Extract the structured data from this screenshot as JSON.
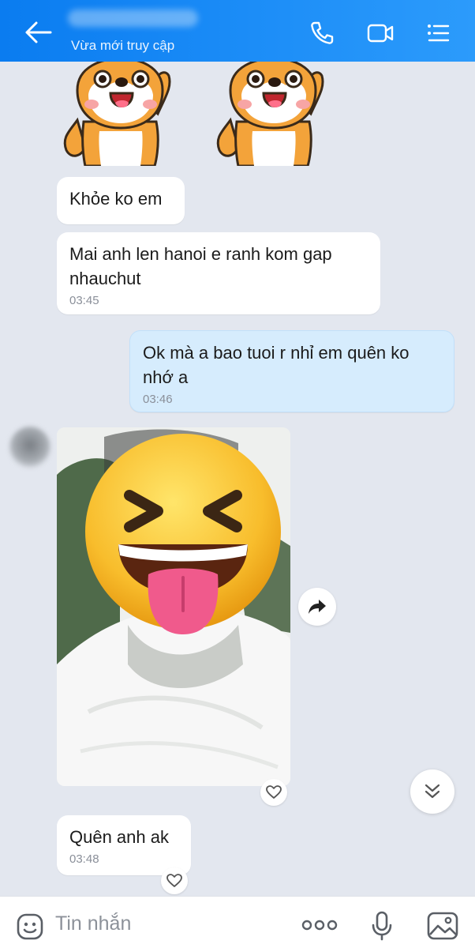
{
  "header": {
    "status": "Vừa mới truy cập",
    "icons": [
      "back-arrow-icon",
      "phone-icon",
      "video-call-icon",
      "menu-list-icon"
    ],
    "color": "#0a7cf0"
  },
  "messages": [
    {
      "id": "b1",
      "direction": "in",
      "text": "Khỏe ko em",
      "time": ""
    },
    {
      "id": "b2",
      "direction": "in",
      "text": "Mai anh len hanoi e ranh kom gap nhauchut",
      "time": "03:45"
    },
    {
      "id": "b3",
      "direction": "out",
      "text": "Ok mà a bao tuoi r nhỉ em quên ko nhớ a",
      "time": "03:46"
    },
    {
      "id": "b4",
      "direction": "in",
      "text": "Quên anh ak",
      "time": "03:48"
    }
  ],
  "input": {
    "placeholder": "Tin nhắn"
  },
  "colors": {
    "background": "#e3e7ef",
    "incoming_bubble": "#ffffff",
    "outgoing_bubble": "#d6ecfd"
  }
}
